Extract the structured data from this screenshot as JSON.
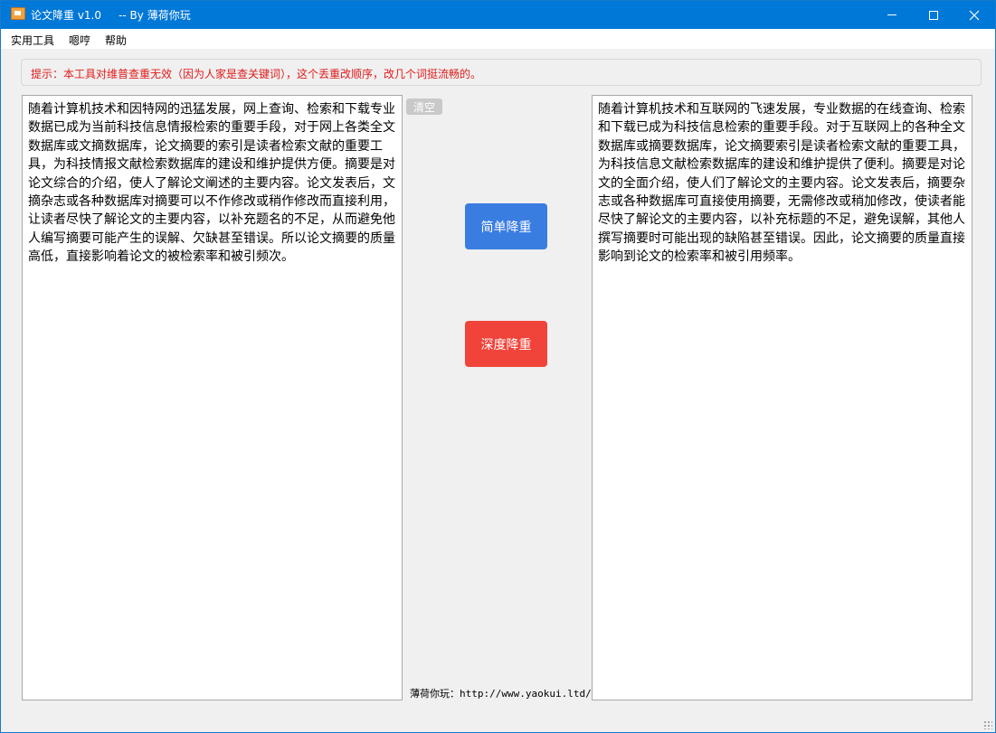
{
  "window": {
    "title": "论文降重 v1.0     -- By 薄荷你玩",
    "icon": "app-icon",
    "minimize_icon": "minimize-icon",
    "maximize_icon": "maximize-icon",
    "close_icon": "close-icon",
    "close_glyph": "✕"
  },
  "menu": {
    "items": [
      "实用工具",
      "嗯哼",
      "帮助"
    ]
  },
  "hint": {
    "text": "提示：本工具对维普查重无效（因为人家是查关键词），这个丢重改顺序，改几个词挺流畅的。",
    "color": "#e11a1a"
  },
  "input": {
    "text": "随着计算机技术和因特网的迅猛发展，网上查询、检索和下载专业数据已成为当前科技信息情报检索的重要手段，对于网上各类全文数据库或文摘数据库，论文摘要的索引是读者检索文献的重要工具，为科技情报文献检索数据库的建设和维护提供方便。摘要是对论文综合的介绍，使人了解论文阐述的主要内容。论文发表后，文摘杂志或各种数据库对摘要可以不作修改或稍作修改而直接利用，让读者尽快了解论文的主要内容，以补充题名的不足，从而避免他人编写摘要可能产生的误解、欠缺甚至错误。所以论文摘要的质量高低，直接影响着论文的被检索率和被引频次。"
  },
  "output": {
    "text": "随着计算机技术和互联网的飞速发展，专业数据的在线查询、检索和下载已成为科技信息检索的重要手段。对于互联网上的各种全文数据库或摘要数据库，论文摘要索引是读者检索文献的重要工具，为科技信息文献检索数据库的建设和维护提供了便利。摘要是对论文的全面介绍，使人们了解论文的主要内容。论文发表后，摘要杂志或各种数据库可直接使用摘要，无需修改或稍加修改，使读者能尽快了解论文的主要内容，以补充标题的不足，避免误解，其他人撰写摘要时可能出现的缺陷甚至错误。因此，论文摘要的质量直接影响到论文的检索率和被引用频率。"
  },
  "buttons": {
    "clear": "清空",
    "simple": "简单降重",
    "deep": "深度降重",
    "simple_color": "#3a7de1",
    "deep_color": "#f0443a"
  },
  "footer": {
    "label": "薄荷你玩：",
    "url": "http://www.yaokui.ltd/"
  }
}
